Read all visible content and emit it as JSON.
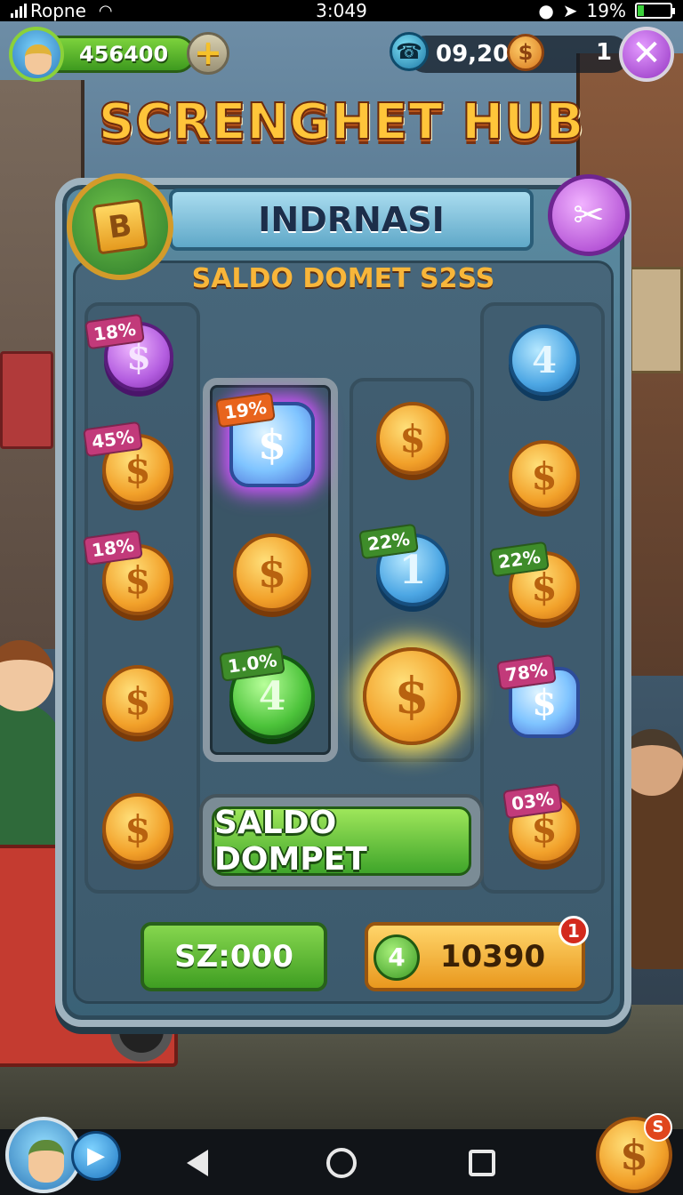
{
  "status_bar": {
    "carrier": "Ropne",
    "time": "3:049",
    "battery": "19%",
    "battery_level": 0.19
  },
  "hud": {
    "currency_amount": "456400",
    "plus_symbol": "+",
    "clock": "09,20",
    "coin_symbol": "$",
    "count": "1",
    "close_symbol": "✕"
  },
  "title": "SCRENGHET HUB",
  "panel": {
    "header": "INDRNASI",
    "subtitle": "SALDO DOMET S2SS",
    "badge_letter": "B",
    "scissors_symbol": "✂"
  },
  "coins": {
    "left": [
      {
        "tag": "18%",
        "symbol": "$",
        "color": "purple"
      },
      {
        "tag": "45%",
        "symbol": "$",
        "color": "gold"
      },
      {
        "tag": "18%",
        "symbol": "$",
        "color": "gold"
      },
      {
        "tag": "",
        "symbol": "$",
        "color": "gold"
      },
      {
        "tag": "",
        "symbol": "$",
        "color": "gold"
      }
    ],
    "center_left": [
      {
        "tag": "19%",
        "symbol": "$",
        "color": "gem-blue"
      },
      {
        "tag": "",
        "symbol": "$",
        "color": "gold"
      },
      {
        "tag": "1.0%",
        "symbol": "4",
        "color": "green"
      }
    ],
    "center_right": [
      {
        "tag": "",
        "symbol": "$",
        "color": "gold"
      },
      {
        "tag": "22%",
        "symbol": "1",
        "color": "blue"
      },
      {
        "tag": "",
        "symbol": "$",
        "color": "gold"
      }
    ],
    "right": [
      {
        "tag": "",
        "symbol": "4",
        "color": "blue"
      },
      {
        "tag": "",
        "symbol": "$",
        "color": "gold"
      },
      {
        "tag": "22%",
        "symbol": "$",
        "color": "gold"
      },
      {
        "tag": "78%",
        "symbol": "$",
        "color": "gem-blue"
      },
      {
        "tag": "03%",
        "symbol": "$",
        "color": "gold"
      }
    ]
  },
  "main_button": "SALDO DOMPET",
  "bottom": {
    "green_button": "SZ:000",
    "gold_button": "10390",
    "gold_coin_symbol": "4",
    "notification_count": "1",
    "coin_badge": "S",
    "coin_symbol": "$",
    "play_symbol": "▶"
  }
}
